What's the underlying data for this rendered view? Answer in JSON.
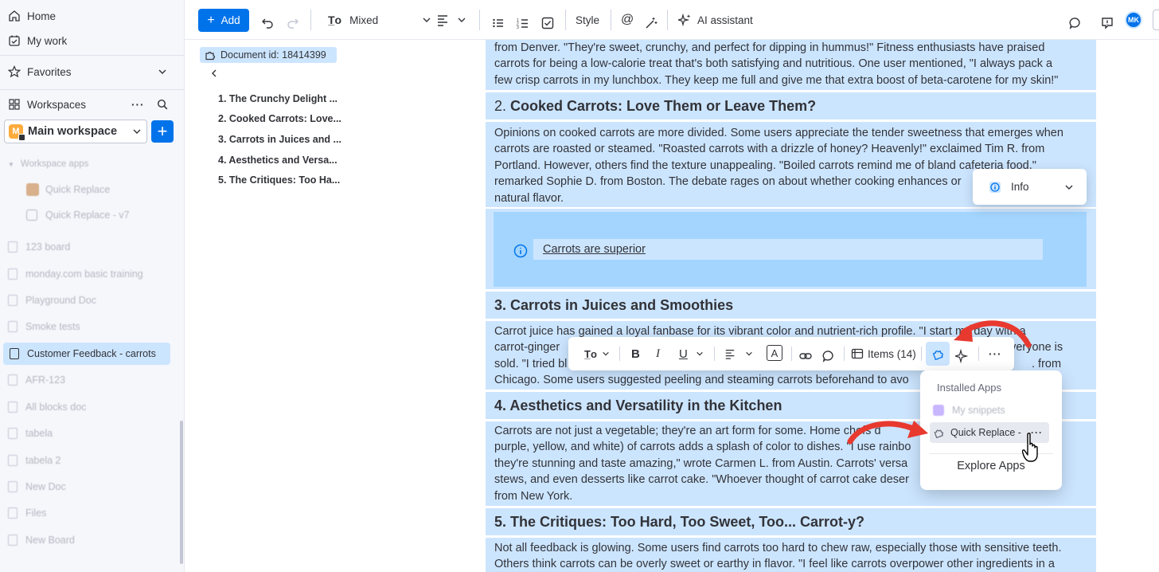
{
  "sidebar": {
    "home": "Home",
    "my_work": "My work",
    "favorites": "Favorites",
    "workspaces": "Workspaces",
    "workspace_name": "Main workspace",
    "workspace_badge": "M",
    "workspace_apps": "Workspace apps",
    "apps": [
      "Quick Replace",
      "Quick Replace - v7"
    ],
    "items": [
      "123 board",
      "monday.com basic training",
      "Playground Doc",
      "Smoke tests",
      "Customer Feedback - carrots",
      "AFR-123",
      "All blocks doc",
      "tabela",
      "tabela 2",
      "New Doc",
      "Files",
      "New Board"
    ],
    "active_item": "Customer Feedback - carrots"
  },
  "toolbar": {
    "add": "Add",
    "text_type": "Mixed",
    "style": "Style",
    "ai": "AI assistant",
    "avatar": "MK"
  },
  "outline": {
    "doc_id": "Document id: 18414399",
    "items": [
      "1. The Crunchy Delight ...",
      "2. Cooked Carrots: Love...",
      "3. Carrots in Juices and ...",
      "4. Aesthetics and Versa...",
      "5. The Critiques: Too Ha..."
    ]
  },
  "doc": {
    "p1": [
      "from Denver. \"They're sweet, crunchy, and perfect for dipping in hummus!\" Fitness enthusiasts have praised",
      "carrots for being a low-calorie treat that's both satisfying and nutritious. One user mentioned, \"I always pack a",
      "few crisp carrots in my lunchbox. They keep me full and give me that extra boost of beta-carotene for my skin!\""
    ],
    "h2_num": "2.",
    "h2": "Cooked Carrots: Love Them or Leave Them?",
    "p2": [
      "Opinions on cooked carrots are more divided. Some users appreciate the tender sweetness that emerges when",
      "carrots are roasted or steamed. \"Roasted carrots with a drizzle of honey? Heavenly!\" exclaimed Tim R. from",
      "Portland. However, others find the texture unappealing. \"Boiled carrots remind me of bland cafeteria food,\"",
      "remarked Sophie D. from Boston. The debate rages on about whether cooking enhances or",
      "natural flavor."
    ],
    "info_text": "Carrots are superior",
    "h3": "3. Carrots in Juices and Smoothies",
    "p3": [
      "Carrot juice has gained a loyal fanbase for its vibrant color and nutrient-rich profile. \"I start my day with a",
      "carrot-ginger",
      "everyone is",
      "sold. \"I tried bl",
      ". from",
      "Chicago. Some users suggested peeling and steaming carrots beforehand to avo"
    ],
    "h4": "4. Aesthetics and Versatility in the Kitchen",
    "p4": [
      "Carrots are not just a vegetable; they're an art form for some. Home chefs d",
      "purple, yellow, and white) of carrots adds a splash of color to dishes. \"I use rainbo",
      "they're stunning and taste amazing,\" wrote Carmen L. from Austin. Carrots' versa",
      "stews, and even desserts like carrot cake. \"Whoever thought of carrot cake deser",
      "from New York."
    ],
    "h5": "5. The Critiques: Too Hard, Too Sweet, Too... Carrot-y?",
    "p5": [
      "Not all feedback is glowing. Some users find carrots too hard to chew raw, especially those with sensitive teeth.",
      "Others think carrots can be overly sweet or earthy in flavor. \"I feel like carrots overpower other ingredients in a"
    ]
  },
  "info_dropdown": {
    "label": "Info"
  },
  "float_toolbar": {
    "items_label": "Items (14)"
  },
  "apps_menu": {
    "title": "Installed Apps",
    "my_snippets": "My snippets",
    "quick_replace": "Quick Replace -",
    "explore": "Explore Apps"
  },
  "colors": {
    "accent": "#0073ea",
    "selection": "#cce5ff",
    "info_block": "#a3d5ff",
    "arrow": "#e8392f"
  }
}
